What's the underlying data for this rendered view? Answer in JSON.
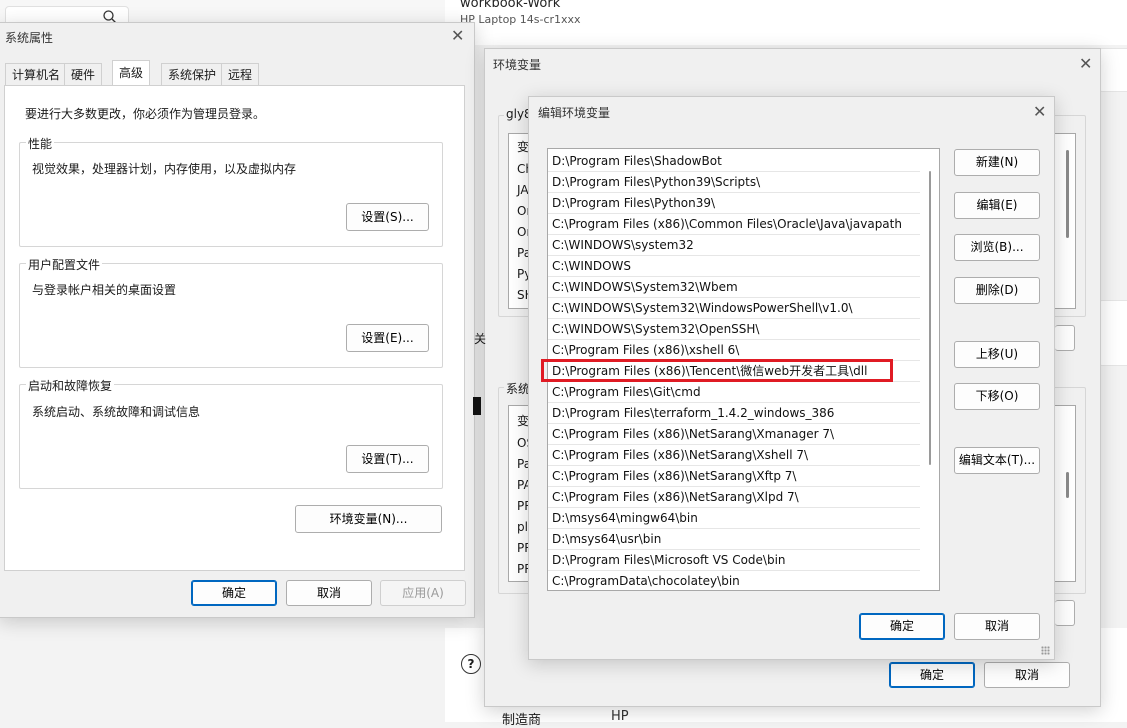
{
  "background_app": {
    "title": "workbook-Work",
    "subtitle": "HP Laptop 14s-cr1xxx",
    "maker_label": "制造商",
    "maker_value": "HP",
    "help_icon": "help-circle-icon",
    "search_icon": "search-icon"
  },
  "system_props": {
    "title": "系统属性",
    "tabs": [
      "计算机名",
      "硬件",
      "高级",
      "系统保护",
      "远程"
    ],
    "active_tab": "高级",
    "admin_note": "要进行大多数更改，你必须作为管理员登录。",
    "performance": {
      "label": "性能",
      "desc": "视觉效果，处理器计划，内存使用，以及虚拟内存",
      "button": "设置(S)..."
    },
    "user_profiles": {
      "label": "用户配置文件",
      "desc": "与登录帐户相关的桌面设置",
      "button": "设置(E)..."
    },
    "startup": {
      "label": "启动和故障恢复",
      "desc": "系统启动、系统故障和调试信息",
      "button": "设置(T)..."
    },
    "env_button": "环境变量(N)...",
    "ok": "确定",
    "cancel": "取消",
    "apply": "应用(A)"
  },
  "env_vars": {
    "title": "环境变量",
    "user_group_label": "gly8",
    "system_group_label": "系统",
    "side_label": "关",
    "user_vars_peek": [
      "变",
      "Ch",
      "JA",
      "Or",
      "Or",
      "Pa",
      "Py",
      "SH"
    ],
    "system_vars_peek": [
      "变",
      "OS",
      "Pa",
      "PA",
      "PR",
      "pl",
      "PR",
      "PR"
    ],
    "ok": "确定",
    "cancel": "取消"
  },
  "edit_env": {
    "title": "编辑环境变量",
    "paths": [
      "D:\\Program Files\\ShadowBot",
      "D:\\Program Files\\Python39\\Scripts\\",
      "D:\\Program Files\\Python39\\",
      "C:\\Program Files (x86)\\Common Files\\Oracle\\Java\\javapath",
      "C:\\WINDOWS\\system32",
      "C:\\WINDOWS",
      "C:\\WINDOWS\\System32\\Wbem",
      "C:\\WINDOWS\\System32\\WindowsPowerShell\\v1.0\\",
      "C:\\WINDOWS\\System32\\OpenSSH\\",
      "C:\\Program Files (x86)\\xshell 6\\",
      "D:\\Program Files (x86)\\Tencent\\微信web开发者工具\\dll",
      "C:\\Program Files\\Git\\cmd",
      "D:\\Program Files\\terraform_1.4.2_windows_386",
      "C:\\Program Files (x86)\\NetSarang\\Xmanager 7\\",
      "C:\\Program Files (x86)\\NetSarang\\Xshell 7\\",
      "C:\\Program Files (x86)\\NetSarang\\Xftp 7\\",
      "C:\\Program Files (x86)\\NetSarang\\Xlpd 7\\",
      "D:\\msys64\\mingw64\\bin",
      "D:\\msys64\\usr\\bin",
      "D:\\Program Files\\Microsoft VS Code\\bin",
      "C:\\ProgramData\\chocolatey\\bin"
    ],
    "highlighted_index": 10,
    "buttons": {
      "new": "新建(N)",
      "edit": "编辑(E)",
      "browse": "浏览(B)...",
      "delete": "删除(D)",
      "move_up": "上移(U)",
      "move_down": "下移(O)",
      "edit_text": "编辑文本(T)..."
    },
    "ok": "确定",
    "cancel": "取消",
    "highlight_color": "#e01b24"
  }
}
